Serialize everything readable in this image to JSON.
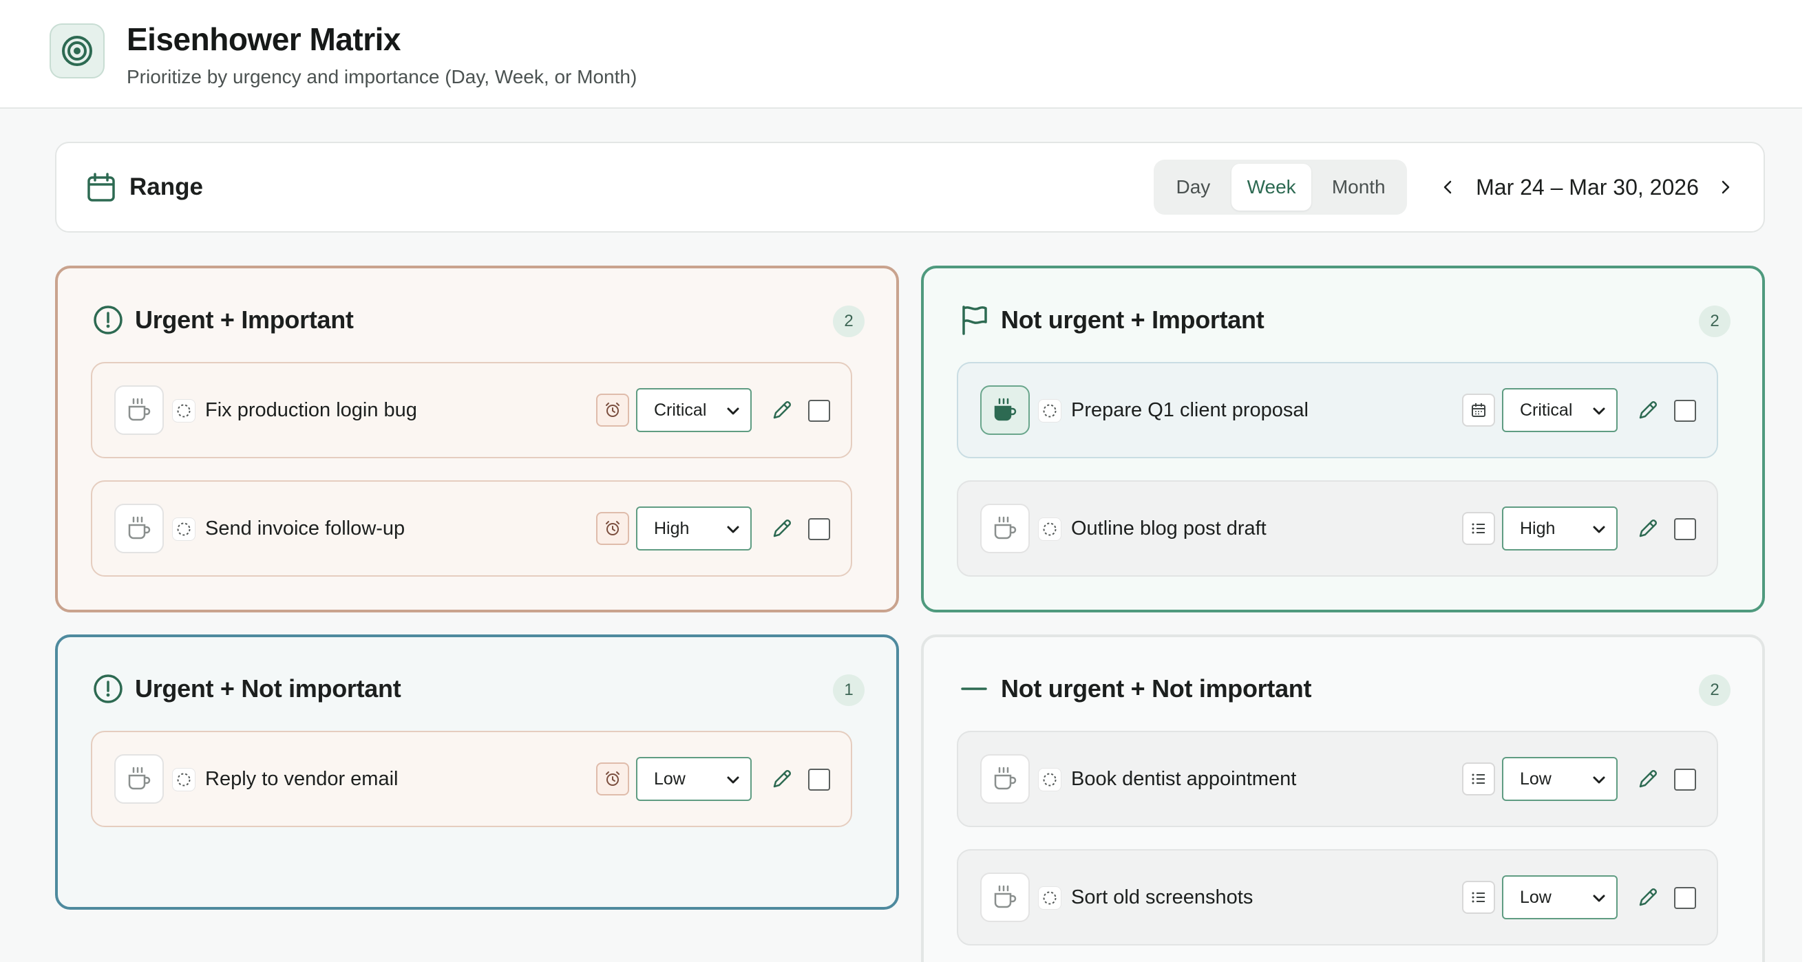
{
  "header": {
    "title": "Eisenhower Matrix",
    "subtitle": "Prioritize by urgency and importance (Day, Week, or Month)",
    "logo_icon": "target-icon"
  },
  "range": {
    "label": "Range",
    "icon": "calendar-icon",
    "options": [
      "Day",
      "Week",
      "Month"
    ],
    "selected": "Week",
    "date_range": "Mar 24 – Mar 30, 2026",
    "prev_icon": "chevron-left-icon",
    "next_icon": "chevron-right-icon"
  },
  "colors": {
    "accent": "#2d6a52",
    "q1_border": "#c9a38e",
    "q2_border": "#4f9a7e",
    "q3_border": "#4e8a9e",
    "q4_border": "#e3e6e5"
  },
  "quadrants": [
    {
      "id": "urgent-important",
      "title": "Urgent + Important",
      "icon": "alert-circle-icon",
      "count": "2",
      "tasks": [
        {
          "label": "Fix production login bug",
          "priority": "Critical",
          "type_icon": "alarm-clock-icon",
          "focused": false
        },
        {
          "label": "Send invoice follow-up",
          "priority": "High",
          "type_icon": "alarm-clock-icon",
          "focused": false
        }
      ]
    },
    {
      "id": "not-urgent-important",
      "title": "Not urgent + Important",
      "icon": "flag-icon",
      "count": "2",
      "tasks": [
        {
          "label": "Prepare Q1 client proposal",
          "priority": "Critical",
          "type_icon": "calendar-icon",
          "focused": true
        },
        {
          "label": "Outline blog post draft",
          "priority": "High",
          "type_icon": "list-icon",
          "focused": false
        }
      ]
    },
    {
      "id": "urgent-not-important",
      "title": "Urgent + Not important",
      "icon": "alert-circle-icon",
      "count": "1",
      "tasks": [
        {
          "label": "Reply to vendor email",
          "priority": "Low",
          "type_icon": "alarm-clock-icon",
          "focused": false
        }
      ]
    },
    {
      "id": "not-urgent-not-important",
      "title": "Not urgent + Not important",
      "icon": "minus-icon",
      "count": "2",
      "tasks": [
        {
          "label": "Book dentist appointment",
          "priority": "Low",
          "type_icon": "list-icon",
          "focused": false
        },
        {
          "label": "Sort old screenshots",
          "priority": "Low",
          "type_icon": "list-icon",
          "focused": false
        }
      ]
    }
  ]
}
